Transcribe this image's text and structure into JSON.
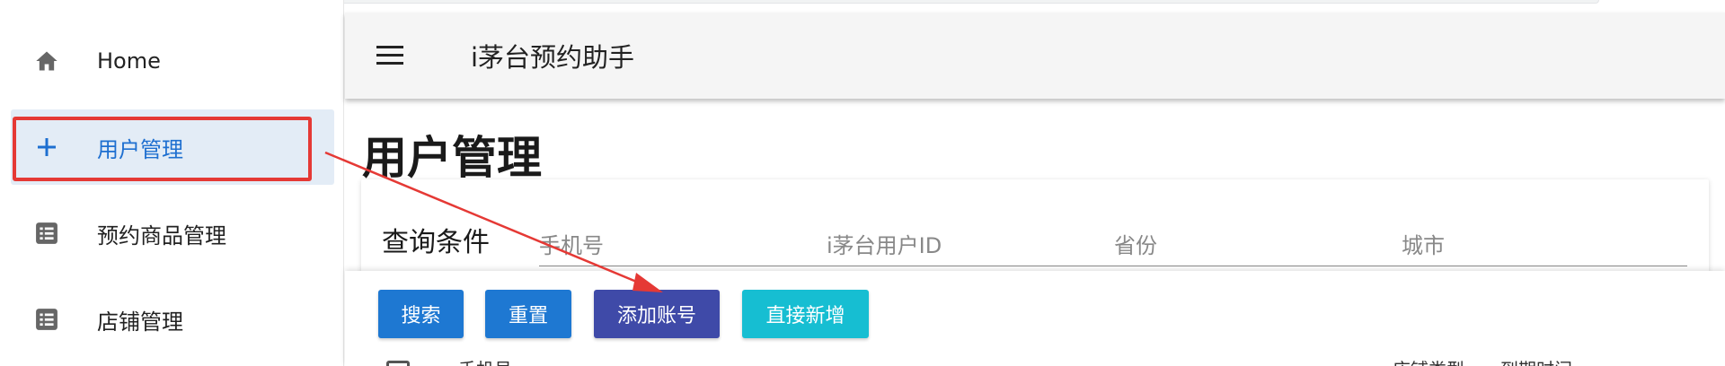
{
  "app": {
    "title": "i茅台预约助手"
  },
  "sidebar": {
    "items": [
      {
        "label": "Home",
        "icon": "home-icon"
      },
      {
        "label": "用户管理",
        "icon": "plus-icon",
        "active": true
      },
      {
        "label": "预约商品管理",
        "icon": "list-icon"
      },
      {
        "label": "店铺管理",
        "icon": "list-icon"
      }
    ]
  },
  "main": {
    "page_title": "用户管理",
    "query": {
      "title": "查询条件",
      "fields": [
        "手机号",
        "i茅台用户ID",
        "省份",
        "城市"
      ]
    },
    "buttons": {
      "search": "搜索",
      "reset": "重置",
      "add_account": "添加账号",
      "direct_add": "直接新增"
    },
    "table_headers_partial": [
      "手机号",
      "店铺类型",
      "到期时间"
    ]
  },
  "colors": {
    "accent": "#1e78d2",
    "indigo": "#3f4aa8",
    "cyan": "#16bed2",
    "annotation": "#e53935",
    "active_bg": "#e3ecf6"
  }
}
